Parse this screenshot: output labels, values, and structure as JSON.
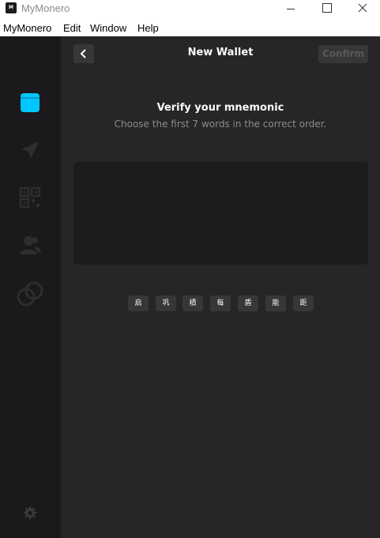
{
  "window": {
    "title": "MyMonero",
    "icon_label": "M"
  },
  "menu": [
    "MyMonero",
    "Edit",
    "Window",
    "Help"
  ],
  "sidebar": {
    "items": [
      {
        "name": "wallets-icon",
        "active": true
      },
      {
        "name": "send-icon",
        "active": false
      },
      {
        "name": "qr-code-icon",
        "active": false
      },
      {
        "name": "contacts-icon",
        "active": false
      },
      {
        "name": "exchange-icon",
        "active": false
      }
    ],
    "settings": "gear-icon"
  },
  "nav": {
    "back_icon": "chevron-left-icon",
    "title": "New Wallet",
    "confirm_label": "Confirm"
  },
  "content": {
    "heading": "Verify your mnemonic",
    "subtitle": "Choose the first 7 words in the correct order.",
    "words": [
      "启",
      "巩",
      "樍",
      "每",
      "盾",
      "能",
      "距"
    ]
  },
  "colors": {
    "accent": "#00c6ff",
    "sidebar_bg": "#1b191b",
    "main_bg": "#272527",
    "chip_bg": "#383638",
    "inactive_icon": "#2f2d2f"
  }
}
